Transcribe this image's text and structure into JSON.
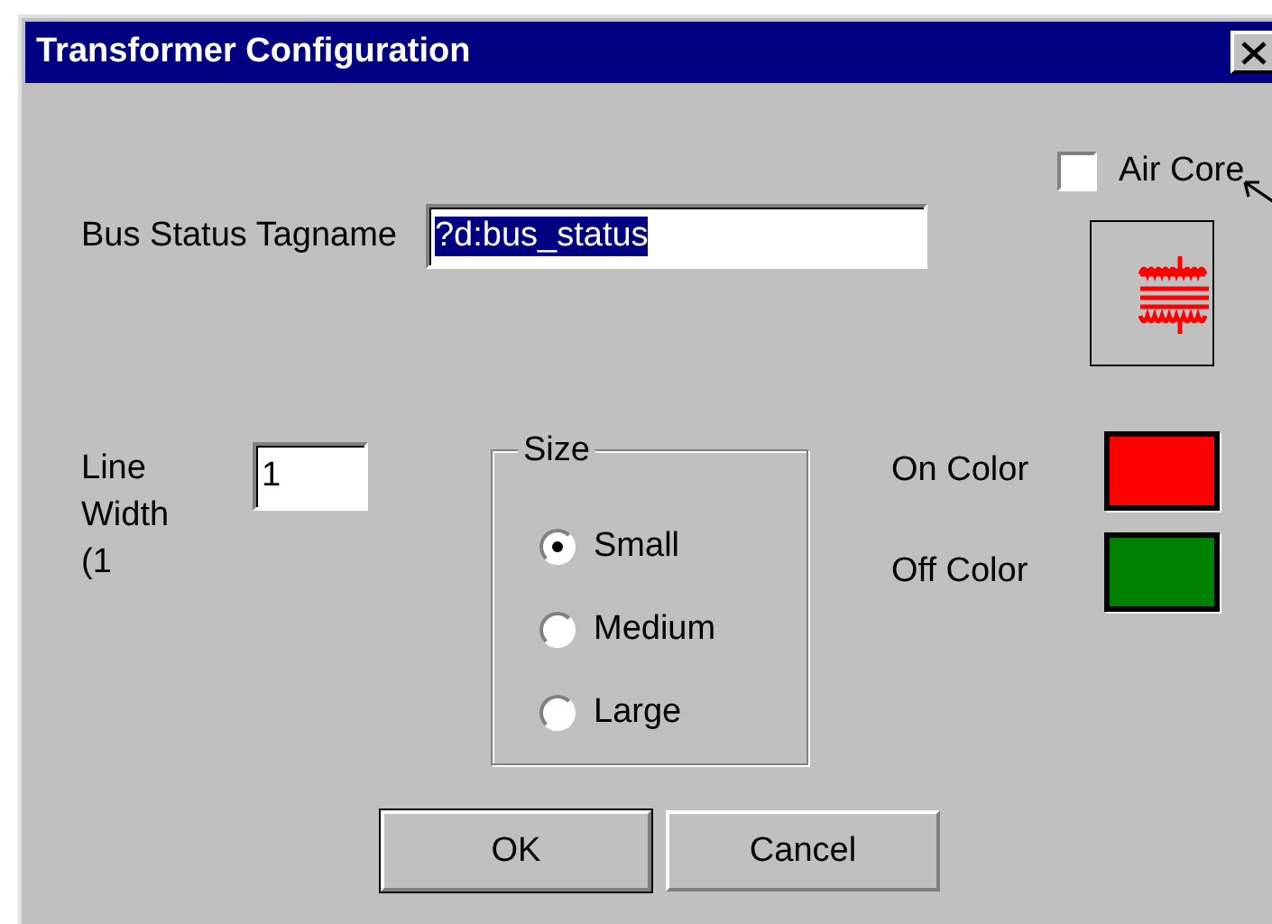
{
  "window": {
    "title": "Transformer Configuration"
  },
  "air_core": {
    "label": "Air Core",
    "checked": false
  },
  "bus_status": {
    "label": "Bus Status Tagname",
    "value": "?d:bus_status",
    "highlighted": true
  },
  "line_width": {
    "label": "Line Width (1",
    "value": "1"
  },
  "size": {
    "label": "Size",
    "options": [
      {
        "label": "Small",
        "selected": true
      },
      {
        "label": "Medium",
        "selected": false
      },
      {
        "label": "Large",
        "selected": false
      }
    ]
  },
  "colors": [
    {
      "label": "On Color",
      "color": "#ff0000"
    },
    {
      "label": "Off Color",
      "color": "#008000"
    }
  ],
  "buttons": [
    {
      "label": "OK",
      "default": true
    },
    {
      "label": "Cancel",
      "default": false
    }
  ]
}
